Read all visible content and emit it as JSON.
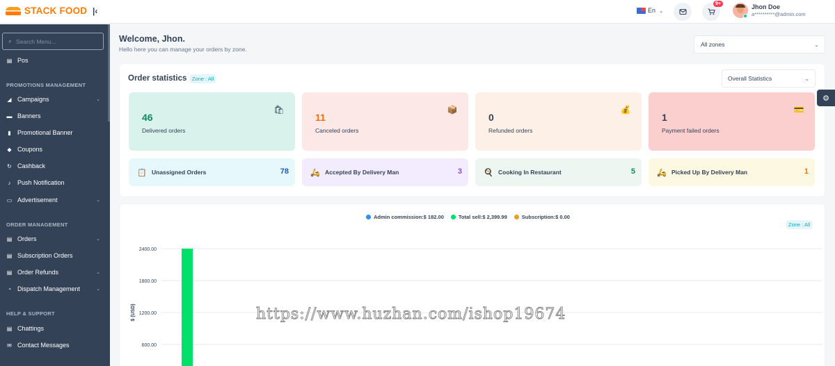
{
  "header": {
    "brand": "STACK FOOD",
    "language": "En",
    "cart_badge": "9+",
    "user_name": "Jhon Doe",
    "user_email": "a**********@admin.com"
  },
  "sidebar": {
    "search_placeholder": "Search Menu...",
    "pos_label": "Pos",
    "promotions_title": "PROMOTIONS MANAGEMENT",
    "promotions": [
      {
        "label": "Campaigns",
        "icon": "megaphone-icon",
        "has_submenu": true
      },
      {
        "label": "Banners",
        "icon": "banner-icon",
        "has_submenu": false
      },
      {
        "label": "Promotional Banner",
        "icon": "promo-banner-icon",
        "has_submenu": false
      },
      {
        "label": "Coupons",
        "icon": "coupon-icon",
        "has_submenu": false
      },
      {
        "label": "Cashback",
        "icon": "cashback-icon",
        "has_submenu": false
      },
      {
        "label": "Push Notification",
        "icon": "bell-icon",
        "has_submenu": false
      },
      {
        "label": "Advertisement",
        "icon": "advertisement-icon",
        "has_submenu": true
      }
    ],
    "orders_title": "ORDER MANAGEMENT",
    "orders": [
      {
        "label": "Orders",
        "icon": "orders-icon",
        "has_submenu": true
      },
      {
        "label": "Subscription Orders",
        "icon": "subscription-icon",
        "has_submenu": false
      },
      {
        "label": "Order Refunds",
        "icon": "refund-icon",
        "has_submenu": true
      },
      {
        "label": "Dispatch Management",
        "icon": "dispatch-icon",
        "has_submenu": true
      }
    ],
    "help_title": "HELP & SUPPORT",
    "help": [
      {
        "label": "Chattings",
        "icon": "chat-icon"
      },
      {
        "label": "Contact Messages",
        "icon": "mail-icon"
      }
    ]
  },
  "main": {
    "welcome": "Welcome, Jhon.",
    "welcome_sub": "Hello here you can manage your orders by zone.",
    "zone_select": "All zones"
  },
  "stats": {
    "title": "Order statistics",
    "zone_pill": "Zone : All",
    "period_select": "Overall Statistics",
    "big": [
      {
        "value": "46",
        "label": "Delivered orders",
        "bg": "#d9f2eb",
        "color": "#0b8c5c",
        "icon": "delivered-icon"
      },
      {
        "value": "11",
        "label": "Canceled orders",
        "bg": "#fde8e8",
        "color": "#ff6d00",
        "icon": "canceled-icon"
      },
      {
        "value": "0",
        "label": "Refunded orders",
        "bg": "#fdf1e7",
        "color": "#334257",
        "icon": "refund-hand-icon"
      },
      {
        "value": "1",
        "label": "Payment failed orders",
        "bg": "#fccfcf",
        "color": "#334257",
        "icon": "payment-failed-icon"
      }
    ],
    "small": [
      {
        "label": "Unassigned Orders",
        "value": "78",
        "bg": "#e6f8fc",
        "color": "#1e5bb8",
        "icon": "unassigned-icon"
      },
      {
        "label": "Accepted By Delivery Man",
        "value": "3",
        "bg": "#f3ecfe",
        "color": "#8a4fe0",
        "icon": "accepted-icon"
      },
      {
        "label": "Cooking In Restaurant",
        "value": "5",
        "bg": "#edf6f1",
        "color": "#0b8c5c",
        "icon": "cooking-icon"
      },
      {
        "label": "Picked Up By Delivery Man",
        "value": "1",
        "bg": "#fdf8e1",
        "color": "#ff6d00",
        "icon": "pickup-icon"
      }
    ]
  },
  "chart": {
    "zone_pill": "Zone : All",
    "ylabel": "$ (USD)",
    "watermark": "https://www.huzhan.com/ishop19674"
  },
  "chart_data": {
    "type": "bar",
    "series": [
      {
        "name": "Admin commission",
        "legend": "Admin commission:$ 182.00",
        "color": "#2d8ff0",
        "values": [
          182
        ]
      },
      {
        "name": "Total sell",
        "legend": "Total sell:$ 2,399.99",
        "color": "#00e06b",
        "values": [
          2399.99
        ]
      },
      {
        "name": "Subscription",
        "legend": "Subscription:$ 0.00",
        "color": "#e8a020",
        "values": [
          0
        ]
      }
    ],
    "ylabel": "$ (USD)",
    "yticks": [
      "2400.00",
      "1800.00",
      "1200.00",
      "600.00"
    ],
    "ylim": [
      0,
      2400
    ],
    "grid": true
  }
}
